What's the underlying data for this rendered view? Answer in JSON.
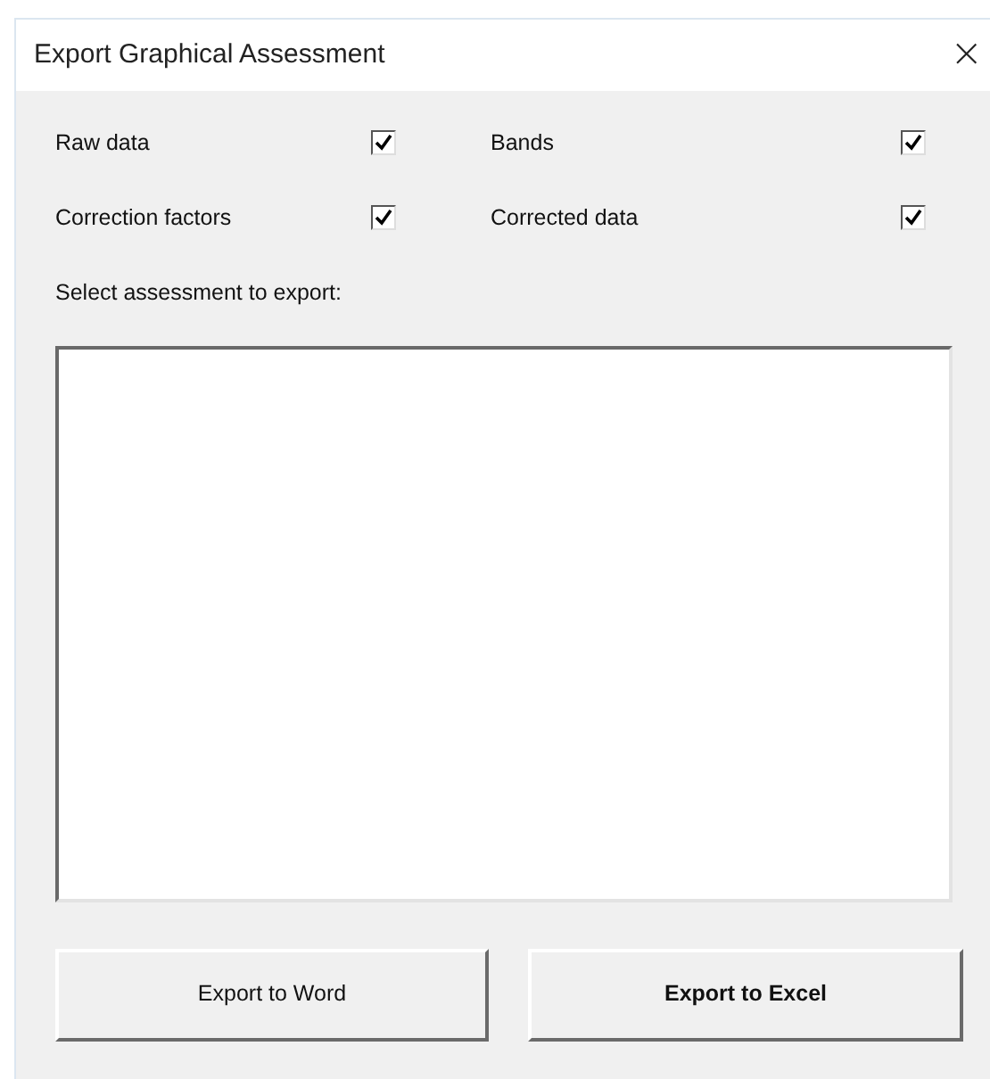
{
  "window": {
    "title": "Export Graphical Assessment",
    "close": "×"
  },
  "options": [
    {
      "label": "Raw data",
      "checked": true
    },
    {
      "label": "Bands",
      "checked": true
    },
    {
      "label": "Correction factors",
      "checked": true
    },
    {
      "label": "Corrected data",
      "checked": true
    }
  ],
  "assessment_list": {
    "label": "Select assessment to export:"
  },
  "buttons": [
    {
      "label": "Export to Word",
      "default": false
    },
    {
      "label": "Export to Excel",
      "default": true
    }
  ]
}
